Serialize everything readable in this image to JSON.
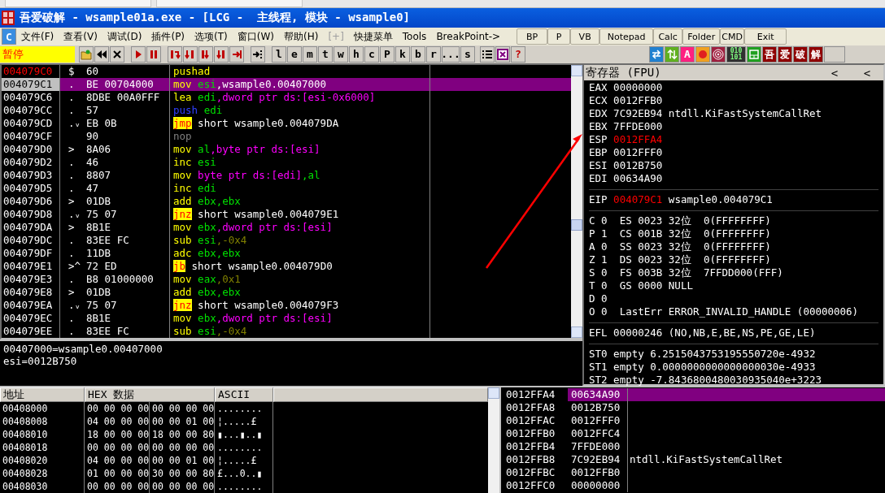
{
  "window": {
    "title": "吾爱破解 - wsample01a.exe - [LCG -  主线程, 模块 - wsample0]"
  },
  "app_icon": "C",
  "menu": [
    {
      "label": "文件(F)",
      "disabled": false
    },
    {
      "label": "查看(V)",
      "disabled": false
    },
    {
      "label": "调试(D)",
      "disabled": false
    },
    {
      "label": "插件(P)",
      "disabled": false
    },
    {
      "label": "选项(T)",
      "disabled": false
    },
    {
      "label": "窗口(W)",
      "disabled": false
    },
    {
      "label": "帮助(H)",
      "disabled": false
    },
    {
      "label": "[+]",
      "disabled": true
    },
    {
      "label": "快捷菜单",
      "disabled": false
    },
    {
      "label": "Tools",
      "disabled": false
    },
    {
      "label": "BreakPoint->",
      "disabled": false
    }
  ],
  "quick_buttons": [
    "BP",
    "P",
    "VB",
    "Notepad",
    "Calc",
    "Folder",
    "CMD",
    "Exit"
  ],
  "toolbar": {
    "status": "暂停",
    "letters": [
      "l",
      "e",
      "m",
      "t",
      "w",
      "h",
      "c",
      "P",
      "k",
      "b",
      "r",
      "...",
      "s"
    ],
    "help": "?",
    "plugin_a": "A",
    "binary": [
      "010",
      "101"
    ],
    "logo": [
      "吾",
      "爱",
      "破",
      "解"
    ]
  },
  "disassembly": {
    "rows": [
      {
        "address": "004079C0",
        "marker": "$",
        "hex": "60",
        "tokens": [
          {
            "text": "pushad",
            "kind": "mnemonic"
          }
        ],
        "selected": false,
        "address_marked": true
      },
      {
        "address": "004079C1",
        "marker": ".",
        "hex": "BE 00704000",
        "tokens": [
          {
            "text": "mov",
            "kind": "mnemonic"
          },
          {
            "text": "esi",
            "kind": "reg"
          },
          {
            "text": ",wsample0.00407000",
            "kind": "text"
          }
        ],
        "selected": true,
        "address_marked": false
      },
      {
        "address": "004079C6",
        "marker": ".",
        "hex": "8DBE 00A0FFF",
        "tokens": [
          {
            "text": "lea",
            "kind": "mnemonic"
          },
          {
            "text": "edi",
            "kind": "reg"
          },
          {
            "text": ",dword ptr ds:[esi-0x6000]",
            "kind": "mem"
          }
        ],
        "selected": false,
        "address_marked": false
      },
      {
        "address": "004079CC",
        "marker": ".",
        "hex": "57",
        "tokens": [
          {
            "text": "push",
            "kind": "push"
          },
          {
            "text": "edi",
            "kind": "reg"
          }
        ],
        "selected": false,
        "address_marked": false
      },
      {
        "address": "004079CD",
        "marker": ".ᵥ",
        "hex": "EB 0B",
        "tokens": [
          {
            "text": "jmp",
            "kind": "jump"
          },
          {
            "text": "short wsample0.004079DA",
            "kind": "text"
          }
        ],
        "selected": false,
        "address_marked": false
      },
      {
        "address": "004079CF",
        "hex": "90",
        "tokens": [
          {
            "text": "nop",
            "kind": "nop"
          }
        ],
        "selected": false,
        "address_marked": false
      },
      {
        "address": "004079D0",
        "marker": ">",
        "hex": "8A06",
        "tokens": [
          {
            "text": "mov",
            "kind": "mnemonic"
          },
          {
            "text": "al",
            "kind": "reg"
          },
          {
            "text": ",byte ptr ds:[esi]",
            "kind": "mem"
          }
        ],
        "selected": false,
        "address_marked": false
      },
      {
        "address": "004079D2",
        "marker": ".",
        "hex": "46",
        "tokens": [
          {
            "text": "inc",
            "kind": "mnemonic"
          },
          {
            "text": "esi",
            "kind": "reg"
          }
        ],
        "selected": false,
        "address_marked": false
      },
      {
        "address": "004079D3",
        "marker": ".",
        "hex": "8807",
        "tokens": [
          {
            "text": "mov",
            "kind": "mnemonic"
          },
          {
            "text": "byte ptr ds:[edi]",
            "kind": "mem"
          },
          {
            "text": ",al",
            "kind": "reg"
          }
        ],
        "selected": false,
        "address_marked": false
      },
      {
        "address": "004079D5",
        "marker": ".",
        "hex": "47",
        "tokens": [
          {
            "text": "inc",
            "kind": "mnemonic"
          },
          {
            "text": "edi",
            "kind": "reg"
          }
        ],
        "selected": false,
        "address_marked": false
      },
      {
        "address": "004079D6",
        "marker": ">",
        "hex": "01DB",
        "tokens": [
          {
            "text": "add",
            "kind": "mnemonic"
          },
          {
            "text": "ebx,ebx",
            "kind": "reg"
          }
        ],
        "selected": false,
        "address_marked": false
      },
      {
        "address": "004079D8",
        "marker": ".ᵥ",
        "hex": "75 07",
        "tokens": [
          {
            "text": "jnz",
            "kind": "jump"
          },
          {
            "text": "short wsample0.004079E1",
            "kind": "text"
          }
        ],
        "selected": false,
        "address_marked": false
      },
      {
        "address": "004079DA",
        "marker": ">",
        "hex": "8B1E",
        "tokens": [
          {
            "text": "mov",
            "kind": "mnemonic"
          },
          {
            "text": "ebx",
            "kind": "reg"
          },
          {
            "text": ",dword ptr ds:[esi]",
            "kind": "mem"
          }
        ],
        "selected": false,
        "address_marked": false
      },
      {
        "address": "004079DC",
        "marker": ".",
        "hex": "83EE FC",
        "tokens": [
          {
            "text": "sub",
            "kind": "mnemonic"
          },
          {
            "text": "esi",
            "kind": "reg"
          },
          {
            "text": ",-0x4",
            "kind": "const"
          }
        ],
        "selected": false,
        "address_marked": false
      },
      {
        "address": "004079DF",
        "marker": ".",
        "hex": "11DB",
        "tokens": [
          {
            "text": "adc",
            "kind": "mnemonic"
          },
          {
            "text": "ebx,ebx",
            "kind": "reg"
          }
        ],
        "selected": false,
        "address_marked": false
      },
      {
        "address": "004079E1",
        "marker": ">^",
        "hex": "72 ED",
        "tokens": [
          {
            "text": "jb",
            "kind": "jump"
          },
          {
            "text": "short wsample0.004079D0",
            "kind": "text"
          }
        ],
        "selected": false,
        "address_marked": false
      },
      {
        "address": "004079E3",
        "marker": ".",
        "hex": "B8 01000000",
        "tokens": [
          {
            "text": "mov",
            "kind": "mnemonic"
          },
          {
            "text": "eax",
            "kind": "reg"
          },
          {
            "text": ",0x1",
            "kind": "const"
          }
        ],
        "selected": false,
        "address_marked": false
      },
      {
        "address": "004079E8",
        "marker": ">",
        "hex": "01DB",
        "tokens": [
          {
            "text": "add",
            "kind": "mnemonic"
          },
          {
            "text": "ebx,ebx",
            "kind": "reg"
          }
        ],
        "selected": false,
        "address_marked": false
      },
      {
        "address": "004079EA",
        "marker": ".ᵥ",
        "hex": "75 07",
        "tokens": [
          {
            "text": "jnz",
            "kind": "jump"
          },
          {
            "text": "short wsample0.004079F3",
            "kind": "text"
          }
        ],
        "selected": false,
        "address_marked": false
      },
      {
        "address": "004079EC",
        "marker": ".",
        "hex": "8B1E",
        "tokens": [
          {
            "text": "mov",
            "kind": "mnemonic"
          },
          {
            "text": "ebx",
            "kind": "reg"
          },
          {
            "text": ",dword ptr ds:[esi]",
            "kind": "mem"
          }
        ],
        "selected": false,
        "address_marked": false
      },
      {
        "address": "004079EE",
        "marker": ".",
        "hex": "83EE FC",
        "tokens": [
          {
            "text": "sub",
            "kind": "mnemonic"
          },
          {
            "text": "esi",
            "kind": "reg"
          },
          {
            "text": ",-0x4",
            "kind": "const"
          }
        ],
        "selected": false,
        "address_marked": false
      }
    ]
  },
  "info": [
    "00407000=wsample0.00407000",
    "esi=0012B750"
  ],
  "registers": {
    "title": "寄存器 (FPU)",
    "nav": [
      "<",
      "<"
    ],
    "general": [
      {
        "name": "EAX",
        "value": "00000000",
        "changed": false
      },
      {
        "name": "ECX",
        "value": "0012FFB0",
        "changed": false
      },
      {
        "name": "EDX",
        "value": "7C92EB94",
        "comment": "ntdll.KiFastSystemCallRet",
        "changed": false
      },
      {
        "name": "EBX",
        "value": "7FFDE000",
        "changed": false
      },
      {
        "name": "ESP",
        "value": "0012FFA4",
        "changed": true
      },
      {
        "name": "EBP",
        "value": "0012FFF0",
        "changed": false
      },
      {
        "name": "ESI",
        "value": "0012B750",
        "changed": false
      },
      {
        "name": "EDI",
        "value": "00634A90",
        "changed": false
      }
    ],
    "eip": {
      "name": "EIP",
      "value": "004079C1",
      "comment": "wsample0.004079C1",
      "changed": true
    },
    "flags": [
      "C 0  ES 0023 32位  0(FFFFFFFF)",
      "P 1  CS 001B 32位  0(FFFFFFFF)",
      "A 0  SS 0023 32位  0(FFFFFFFF)",
      "Z 1  DS 0023 32位  0(FFFFFFFF)",
      "S 0  FS 003B 32位  7FFDD000(FFF)",
      "T 0  GS 0000 NULL",
      "D 0",
      "O 0  LastErr ERROR_INVALID_HANDLE (00000006)"
    ],
    "efl": "EFL 00000246 (NO,NB,E,BE,NS,PE,GE,LE)",
    "fpu": [
      "ST0 empty 6.2515043753195550720e-4932",
      "ST1 empty 0.0000000000000000030e-4933",
      "ST2 empty -7.8436800480030935040e+3223"
    ]
  },
  "dump": {
    "columns": [
      "地址",
      "HEX 数据",
      "ASCII"
    ],
    "rows": [
      {
        "address": "00408000",
        "hex": [
          "00 00 00 00",
          "00 00 00 00"
        ],
        "ascii": "........"
      },
      {
        "address": "00408008",
        "hex": [
          "04 00 00 00",
          "00 00 01 00"
        ],
        "ascii": "¦.....£"
      },
      {
        "address": "00408010",
        "hex": [
          "18 00 00 00",
          "18 00 00 80"
        ],
        "ascii": "▮...▮..▮"
      },
      {
        "address": "00408018",
        "hex": [
          "00 00 00 00",
          "00 00 00 00"
        ],
        "ascii": "........"
      },
      {
        "address": "00408020",
        "hex": [
          "04 00 00 00",
          "00 00 01 00"
        ],
        "ascii": "¦.....£"
      },
      {
        "address": "00408028",
        "hex": [
          "01 00 00 00",
          "30 00 00 80"
        ],
        "ascii": "£...0..▮"
      },
      {
        "address": "00408030",
        "hex": [
          "00 00 00 00",
          "00 00 00 00"
        ],
        "ascii": "........"
      }
    ]
  },
  "stack": {
    "rows": [
      {
        "address": "0012FFA4",
        "value": "00634A90",
        "selected": true
      },
      {
        "address": "0012FFA8",
        "value": "0012B750",
        "selected": false
      },
      {
        "address": "0012FFAC",
        "value": "0012FFF0",
        "selected": false
      },
      {
        "address": "0012FFB0",
        "value": "0012FFC4",
        "selected": false
      },
      {
        "address": "0012FFB4",
        "value": "7FFDE000",
        "selected": false
      },
      {
        "address": "0012FFB8",
        "value": "7C92EB94",
        "comment": "ntdll.KiFastSystemCallRet",
        "selected": false
      },
      {
        "address": "0012FFBC",
        "value": "0012FFB0",
        "selected": false
      },
      {
        "address": "0012FFC0",
        "value": "00000000",
        "selected": false
      }
    ]
  }
}
